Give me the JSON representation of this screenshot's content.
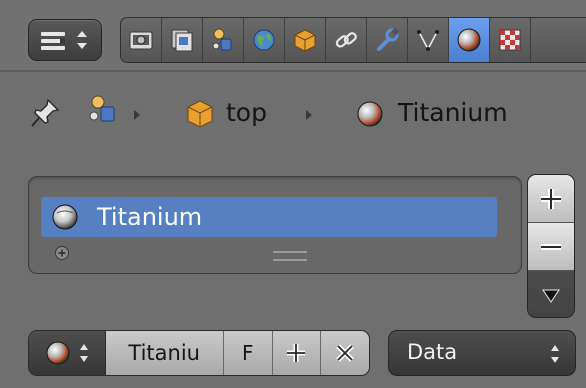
{
  "header": {
    "editor_type_icon": "properties-editor-icon",
    "tabs": [
      {
        "icon": "render-camera-icon"
      },
      {
        "icon": "render-layers-icon"
      },
      {
        "icon": "scene-icon"
      },
      {
        "icon": "world-icon"
      },
      {
        "icon": "object-icon"
      },
      {
        "icon": "constraints-icon"
      },
      {
        "icon": "modifiers-wrench-icon"
      },
      {
        "icon": "object-data-mesh-icon"
      },
      {
        "icon": "material-icon",
        "active": true
      },
      {
        "icon": "texture-icon"
      }
    ]
  },
  "breadcrumb": {
    "pin_icon": "pin-icon",
    "scene_icon": "scene-icon",
    "object_icon": "object-cube-icon",
    "object_name": "top",
    "material_icon": "material-sphere-icon",
    "material_name": "Titanium"
  },
  "material_slots": {
    "items": [
      {
        "label": "Titanium",
        "icon": "material-sphere-icon",
        "selected": true
      }
    ],
    "add_button_icon": "plus-icon",
    "remove_button_icon": "minus-icon",
    "menu_button_icon": "dropdown-triangle-icon"
  },
  "datablock": {
    "browse_icon": "material-sphere-icon",
    "name": "Titaniu",
    "fake_user_label": "F",
    "new_icon": "plus-icon",
    "unlink_icon": "x-icon"
  },
  "link_select": {
    "value": "Data"
  },
  "colors": {
    "background": "#6f6f6f",
    "accent": "#5680c2",
    "active_tab": "#5a8fe0"
  }
}
